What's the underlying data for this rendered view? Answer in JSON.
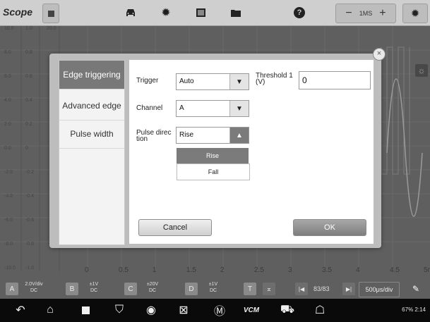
{
  "app": {
    "title": "Scope"
  },
  "toolbar": {
    "time_base": "1MS",
    "minus": "−",
    "plus": "+",
    "icons": [
      "stop-icon",
      "car-icon",
      "gear-icon",
      "monitor-icon",
      "folder-icon",
      "help-icon",
      "settings-icon"
    ]
  },
  "scope": {
    "y_ticks_a": [
      "10.0",
      "8.0",
      "6.0",
      "4.0",
      "2.0",
      "0.0",
      "-2.0",
      "-4.0",
      "-6.0",
      "-8.0",
      "-10.0"
    ],
    "y_ticks_b": [
      "1.0",
      "0.8",
      "0.6",
      "0.4",
      "0.2",
      "0",
      "-0.2",
      "-0.4",
      "-0.6",
      "-0.8",
      "-1.0"
    ],
    "y_ticks_c": [
      "20.0"
    ],
    "x_ticks": [
      "0",
      "0.5",
      "1",
      "1.5",
      "2",
      "2.5",
      "3",
      "3.5",
      "4",
      "4.5",
      "5m"
    ]
  },
  "dialog": {
    "tabs": [
      "Edge triggering",
      "Advanced edge",
      "Pulse width"
    ],
    "active_tab": 0,
    "trigger": {
      "label": "Trigger",
      "value": "Auto"
    },
    "threshold": {
      "label": "Threshold 1\n(V)",
      "value": "0"
    },
    "channel": {
      "label": "Channel",
      "value": "A"
    },
    "pulse_direction": {
      "label": "Pulse direc\ntion",
      "value": "Rise",
      "options": [
        "Rise",
        "Fall"
      ]
    },
    "cancel_label": "Cancel",
    "ok_label": "OK",
    "close_glyph": "×"
  },
  "channels": [
    {
      "id": "A",
      "scale": "2.0V/div",
      "coupling": "DC"
    },
    {
      "id": "B",
      "scale": "±1V",
      "coupling": "DC"
    },
    {
      "id": "C",
      "scale": "±20V",
      "coupling": "DC"
    },
    {
      "id": "D",
      "scale": "±1V",
      "coupling": "DC"
    }
  ],
  "chbar": {
    "t_label": "T",
    "page": "83/83",
    "time_div": "500μs/div"
  },
  "status": {
    "battery": "67%",
    "time": "2:14"
  }
}
